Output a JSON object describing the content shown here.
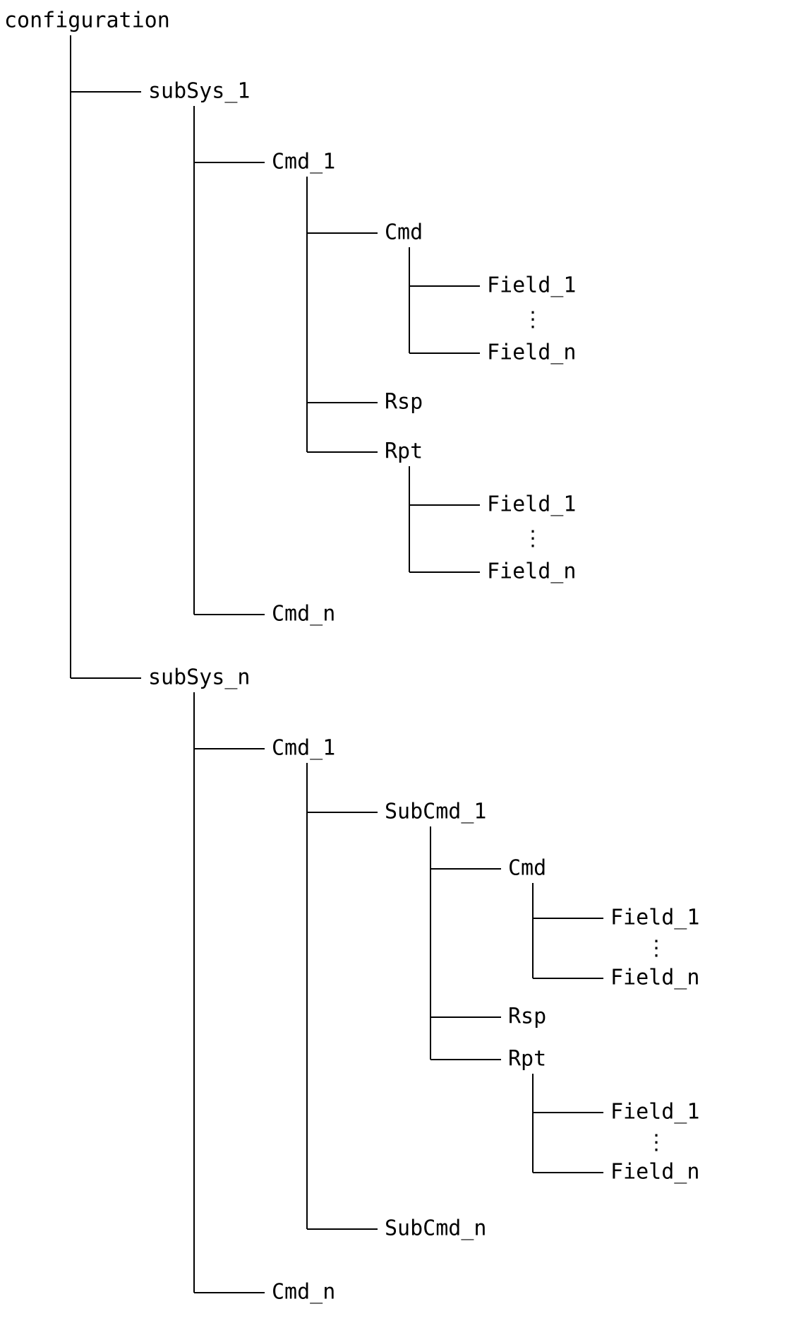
{
  "root": "configuration",
  "ss1": {
    "label": "subSys_1",
    "cmd1": "Cmd_1",
    "cmd_n": "Cmd_n",
    "cmd": "Cmd",
    "rsp": "Rsp",
    "rpt": "Rpt",
    "f1": "Field_1",
    "fn": "Field_n"
  },
  "ssn": {
    "label": "subSys_n",
    "cmd1": "Cmd_1",
    "cmd_n": "Cmd_n",
    "sub1": "SubCmd_1",
    "sub_n": "SubCmd_n",
    "cmd": "Cmd",
    "rsp": "Rsp",
    "rpt": "Rpt",
    "f1": "Field_1",
    "fn": "Field_n"
  },
  "vdots": "⋮"
}
